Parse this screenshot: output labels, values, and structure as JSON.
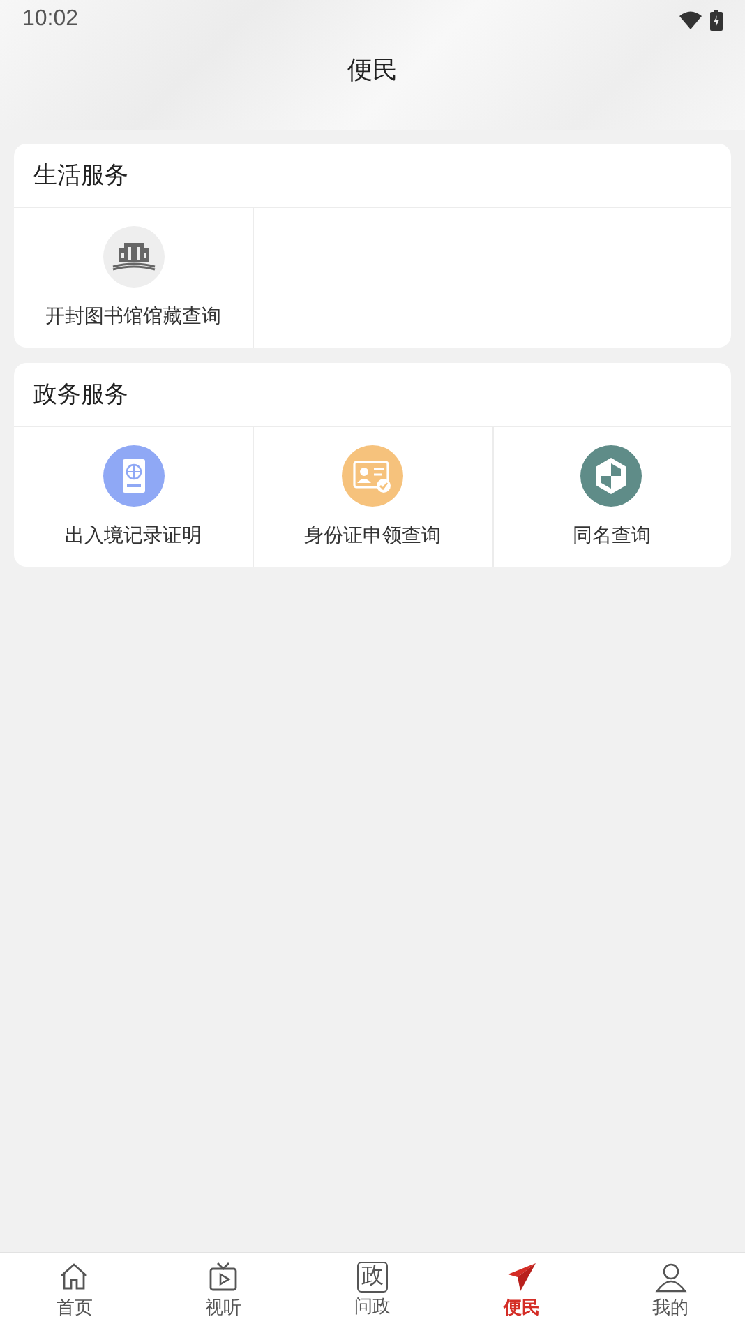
{
  "status_bar": {
    "time": "10:02"
  },
  "header": {
    "title": "便民"
  },
  "sections": [
    {
      "title": "生活服务",
      "items": [
        {
          "label": "开封图书馆馆藏查询",
          "kind": "library",
          "color": "#eeeeee"
        }
      ]
    },
    {
      "title": "政务服务",
      "items": [
        {
          "label": "出入境记录证明",
          "kind": "passport",
          "color": "#8fa8f5"
        },
        {
          "label": "身份证申领查询",
          "kind": "idcard",
          "color": "#f6c27c"
        },
        {
          "label": "同名查询",
          "kind": "hexagon",
          "color": "#5f8c88"
        }
      ]
    }
  ],
  "tab_bar": [
    {
      "label": "首页",
      "kind": "home",
      "selected": false
    },
    {
      "label": "视听",
      "kind": "tv",
      "selected": false
    },
    {
      "label": "问政",
      "kind": "glyph",
      "glyph": "政",
      "selected": false
    },
    {
      "label": "便民",
      "kind": "plane",
      "selected": true
    },
    {
      "label": "我的",
      "kind": "person",
      "selected": false
    }
  ]
}
